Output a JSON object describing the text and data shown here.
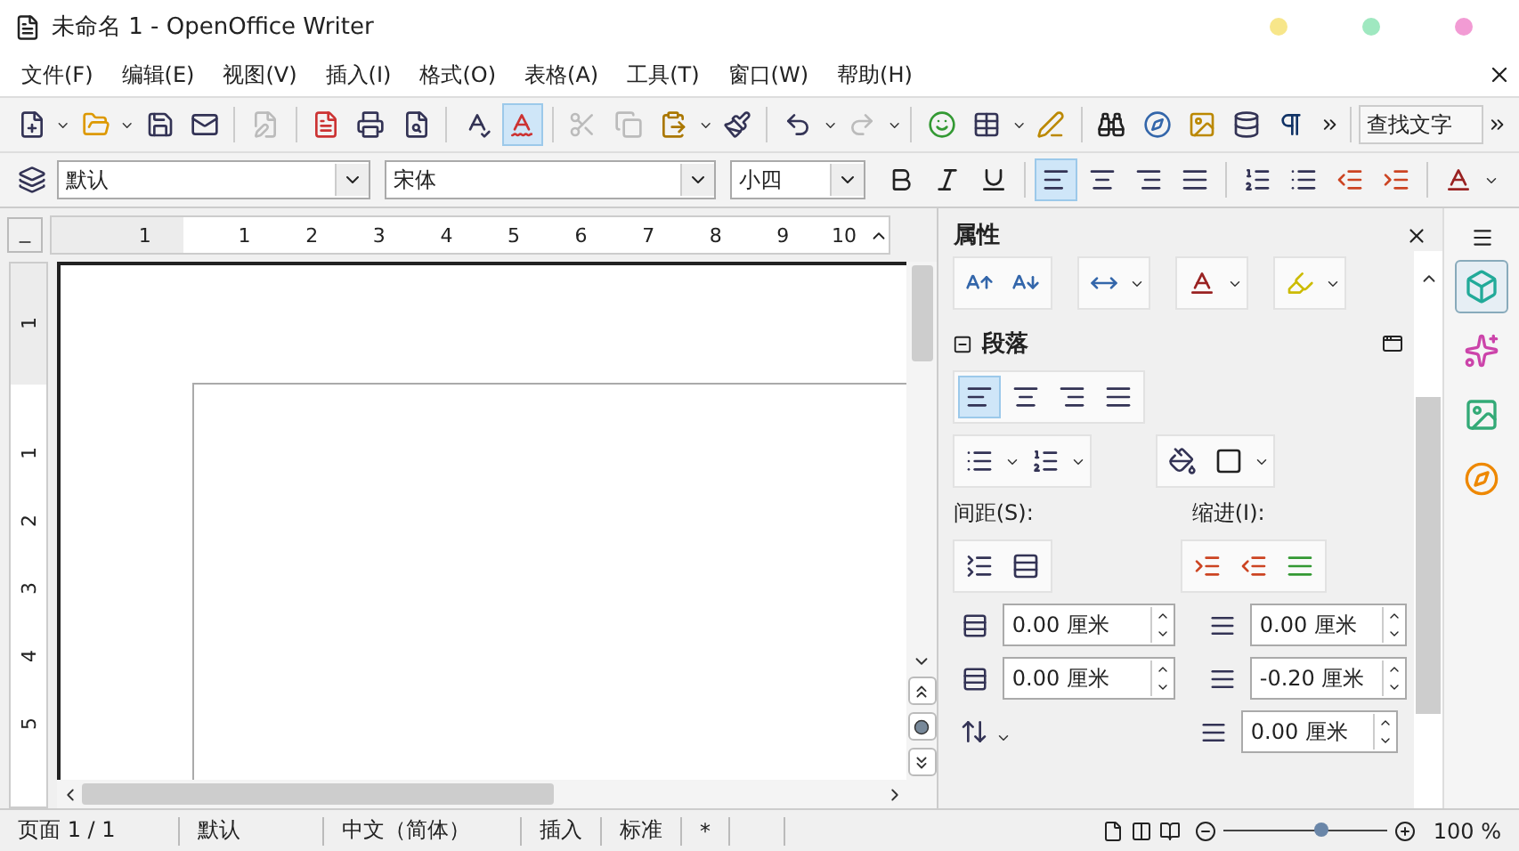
{
  "title_bar": {
    "title": "未命名 1 - OpenOffice Writer",
    "window_buttons": [
      {
        "color": "#f7e68a"
      },
      {
        "color": "#9fe8c0"
      },
      {
        "color": "#f29bd4"
      }
    ]
  },
  "menu": [
    "文件(F)",
    "编辑(E)",
    "视图(V)",
    "插入(I)",
    "格式(O)",
    "表格(A)",
    "工具(T)",
    "窗口(W)",
    "帮助(H)"
  ],
  "standard_toolbar": {
    "autospell_on": true,
    "find_field": {
      "placeholder": "查找文字"
    }
  },
  "formatting_toolbar": {
    "style": "默认",
    "font": "宋体",
    "size": "小四",
    "alignments": [
      {
        "selected": true
      },
      {
        "selected": false
      },
      {
        "selected": false
      },
      {
        "selected": false
      }
    ]
  },
  "ruler": {
    "horizontal": [
      "1",
      "1",
      "2",
      "3",
      "4",
      "5",
      "6",
      "7",
      "8",
      "9",
      "10"
    ],
    "vertical": [
      "1",
      "1",
      "2",
      "3",
      "4",
      "5"
    ]
  },
  "sidebar": {
    "title": "属性",
    "section": {
      "title": "段落",
      "expanded": true
    },
    "alignments": [
      {
        "selected": true
      },
      {
        "selected": false
      },
      {
        "selected": false
      },
      {
        "selected": false
      }
    ],
    "spacing_label": "间距(S):",
    "indent_label": "缩进(I):",
    "spacing_fields": [
      "0.00 厘米",
      "0.00 厘米"
    ],
    "indent_fields": [
      "0.00 厘米",
      "-0.20 厘米",
      "0.00 厘米"
    ],
    "tabs": [
      {
        "selected": true
      },
      {
        "selected": false
      },
      {
        "selected": false
      },
      {
        "selected": false
      }
    ]
  },
  "status_bar": {
    "page": "页面 1 / 1",
    "style": "默认",
    "language": "中文（简体）",
    "insert_mode": "插入",
    "selection_mode": "标准",
    "modified": "*",
    "zoom": {
      "level": 0.6,
      "reading": "100 %"
    }
  }
}
